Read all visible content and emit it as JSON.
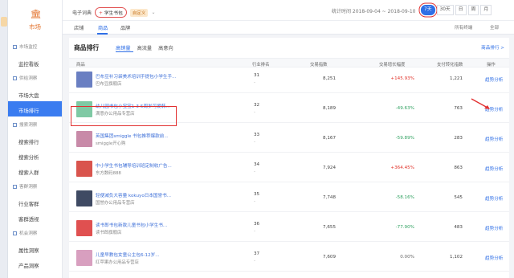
{
  "sidebar": {
    "brand_label": "市场",
    "sections": [
      {
        "label": "市场监控",
        "items": [
          {
            "label": "监控看板",
            "active": false
          }
        ]
      },
      {
        "label": "供给洞察",
        "items": [
          {
            "label": "市场大盘",
            "active": false
          },
          {
            "label": "市场排行",
            "active": true
          }
        ]
      },
      {
        "label": "搜索洞察",
        "items": [
          {
            "label": "搜索排行",
            "active": false
          },
          {
            "label": "搜索分析",
            "active": false
          },
          {
            "label": "搜索人群",
            "active": false
          }
        ]
      },
      {
        "label": "客群洞察",
        "items": [
          {
            "label": "行业客群",
            "active": false
          },
          {
            "label": "客群透视",
            "active": false
          }
        ]
      },
      {
        "label": "机会洞察",
        "items": [
          {
            "label": "属性洞察",
            "active": false
          },
          {
            "label": "产品洞察",
            "active": false
          }
        ]
      }
    ]
  },
  "header": {
    "breadcrumb_root": "电子词典",
    "category_chip": "学生书包",
    "category_chip_prefix": "+",
    "chip_tag": "自定义",
    "date_range_label": "统计时间 2018-09-04 ~ 2018-09-10",
    "periods": [
      "7天",
      "30天",
      "日",
      "周",
      "月"
    ],
    "active_period": "7天"
  },
  "subnav": {
    "tabs": [
      "店铺",
      "商品",
      "品牌"
    ],
    "active_tab": "商品",
    "right_options": [
      "所有终端",
      "全部"
    ]
  },
  "panel": {
    "title": "商品排行",
    "tabs": [
      "高销量",
      "高流量",
      "高意向"
    ],
    "active_tab": "高销量",
    "right_link": "商品排行 >",
    "columns": [
      "商品",
      "行业排名",
      "交易指数",
      "交易增长幅度",
      "支付转化指数",
      "操作"
    ],
    "rows": [
      {
        "name": "巴布豆补习袋美术培训手提包小学生手...",
        "shop": "巴布豆旗舰店",
        "rank": "31",
        "rank_change": "-",
        "trade_index": "8,251",
        "growth": "+145.93%",
        "growth_type": "pos",
        "conversion": "1,221",
        "action": "趋势分析",
        "thumb": "#6a7fc2"
      },
      {
        "name": "幼儿园书包小宝宝1-3-5周岁可爱韩...",
        "shop": "满意办公用品专营店",
        "rank": "32",
        "rank_change": "-",
        "trade_index": "8,189",
        "growth": "-49.63%",
        "growth_type": "neg",
        "conversion": "763",
        "action": "趋势分析",
        "thumb": "#7fc9a4"
      },
      {
        "name": "英国集团smiggle 书包推荐爆款前...",
        "shop": "smiggle开心购",
        "rank": "33",
        "rank_change": "-",
        "trade_index": "8,167",
        "growth": "-59.89%",
        "growth_type": "neg",
        "conversion": "283",
        "action": "趋势分析",
        "thumb": "#c88aa8"
      },
      {
        "name": "中小学生书包辅导培训班定制收广告...",
        "shop": "东方数码888",
        "rank": "34",
        "rank_change": "-",
        "trade_index": "7,924",
        "growth": "+364.45%",
        "growth_type": "pos",
        "conversion": "863",
        "action": "趋势分析",
        "thumb": "#d9544d"
      },
      {
        "name": "轻便减负大容量 kokuyo日本国誉书...",
        "shop": "国誉办公用品专营店",
        "rank": "35",
        "rank_change": "-",
        "trade_index": "7,748",
        "growth": "-58.16%",
        "growth_type": "neg",
        "conversion": "545",
        "action": "趋势分析",
        "thumb": "#3f4a63"
      },
      {
        "name": "读书郎书包新款儿童书包小学生书...",
        "shop": "读书郎旗舰店",
        "rank": "36",
        "rank_change": "-",
        "trade_index": "7,655",
        "growth": "-77.90%",
        "growth_type": "neg",
        "conversion": "483",
        "action": "趋势分析",
        "thumb": "#e05050"
      },
      {
        "name": "儿童早教包女童公主包6-12岁...",
        "shop": "红苹果办公用品专营店",
        "rank": "37",
        "rank_change": "-",
        "trade_index": "7,609",
        "growth": "0.00%",
        "growth_type": "neu",
        "conversion": "1,102",
        "action": "趋势分析",
        "thumb": "#d89fbf"
      }
    ]
  },
  "annotation": {
    "highlight_color": "#e23030"
  }
}
